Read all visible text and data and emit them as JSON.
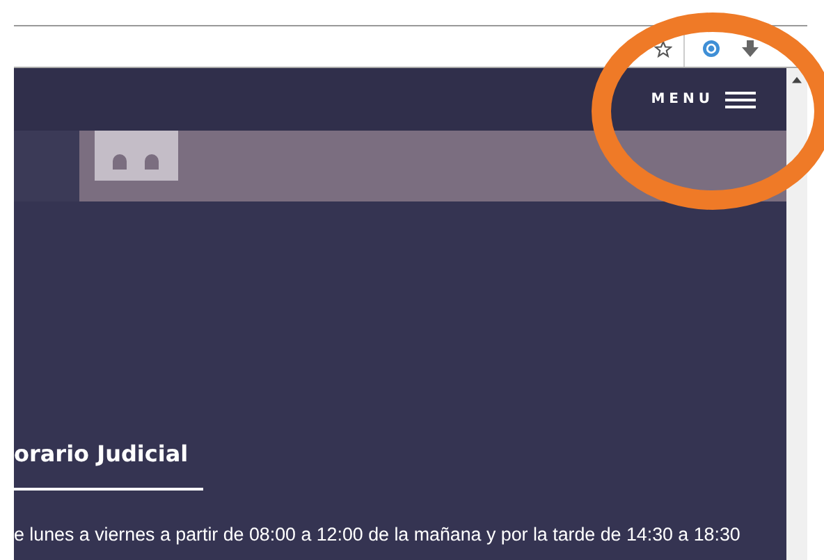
{
  "header": {
    "menu_label": "MENU"
  },
  "section": {
    "heading": "orario Judicial",
    "text": "e lunes a viernes a partir de 08:00 a 12:00 de la mañana y por la tarde de 14:30 a 18:30"
  }
}
